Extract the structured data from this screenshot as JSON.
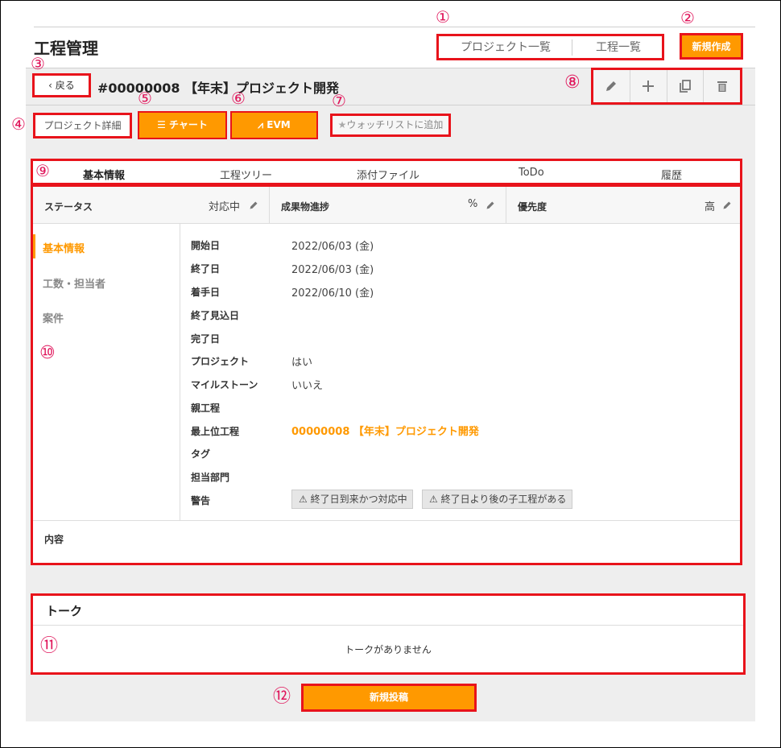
{
  "annotations": [
    "①",
    "②",
    "③",
    "④",
    "⑤",
    "⑥",
    "⑦",
    "⑧",
    "⑨",
    "⑩",
    "⑪",
    "⑫"
  ],
  "header": {
    "title": "工程管理",
    "nav": [
      "プロジェクト一覧",
      "工程一覧"
    ],
    "new_button": "新規作成"
  },
  "project": {
    "back_label": "戻る",
    "title": "#00000008 【年末】プロジェクト開発"
  },
  "toolbar_icons": [
    "pencil-icon",
    "plus-icon",
    "copy-icon",
    "trash-icon"
  ],
  "subnav": {
    "detail": "プロジェクト詳細",
    "chart": "チャート",
    "evm": "EVM",
    "watchlist": "ウォッチリストに追加"
  },
  "tabs": [
    "基本情報",
    "工程ツリー",
    "添付ファイル",
    "ToDo",
    "履歴"
  ],
  "status": {
    "status_label": "ステータス",
    "status_value": "対応中",
    "progress_label": "成果物進捗",
    "progress_value": "%",
    "priority_label": "優先度",
    "priority_value": "高"
  },
  "sidebar": [
    "基本情報",
    "工数・担当者",
    "案件"
  ],
  "fields": [
    {
      "label": "開始日",
      "value": "2022/06/03 (金)"
    },
    {
      "label": "終了日",
      "value": "2022/06/03 (金)"
    },
    {
      "label": "着手日",
      "value": "2022/06/10 (金)"
    },
    {
      "label": "終了見込日",
      "value": ""
    },
    {
      "label": "完了日",
      "value": ""
    },
    {
      "label": "プロジェクト",
      "value": "はい"
    },
    {
      "label": "マイルストーン",
      "value": "いいえ"
    },
    {
      "label": "親工程",
      "value": ""
    },
    {
      "label": "最上位工程",
      "value": "00000008 【年末】プロジェクト開発"
    },
    {
      "label": "タグ",
      "value": ""
    },
    {
      "label": "担当部門",
      "value": ""
    },
    {
      "label": "警告",
      "value": ""
    }
  ],
  "warnings": [
    "終了日到来かつ対応中",
    "終了日より後の子工程がある"
  ],
  "content_label": "内容",
  "talk": {
    "title": "トーク",
    "empty": "トークがありません",
    "post_button": "新規投稿"
  },
  "colors": {
    "accent": "#ff9900",
    "annotation_box": "#e8131b",
    "annotation_number": "#e0145a"
  }
}
